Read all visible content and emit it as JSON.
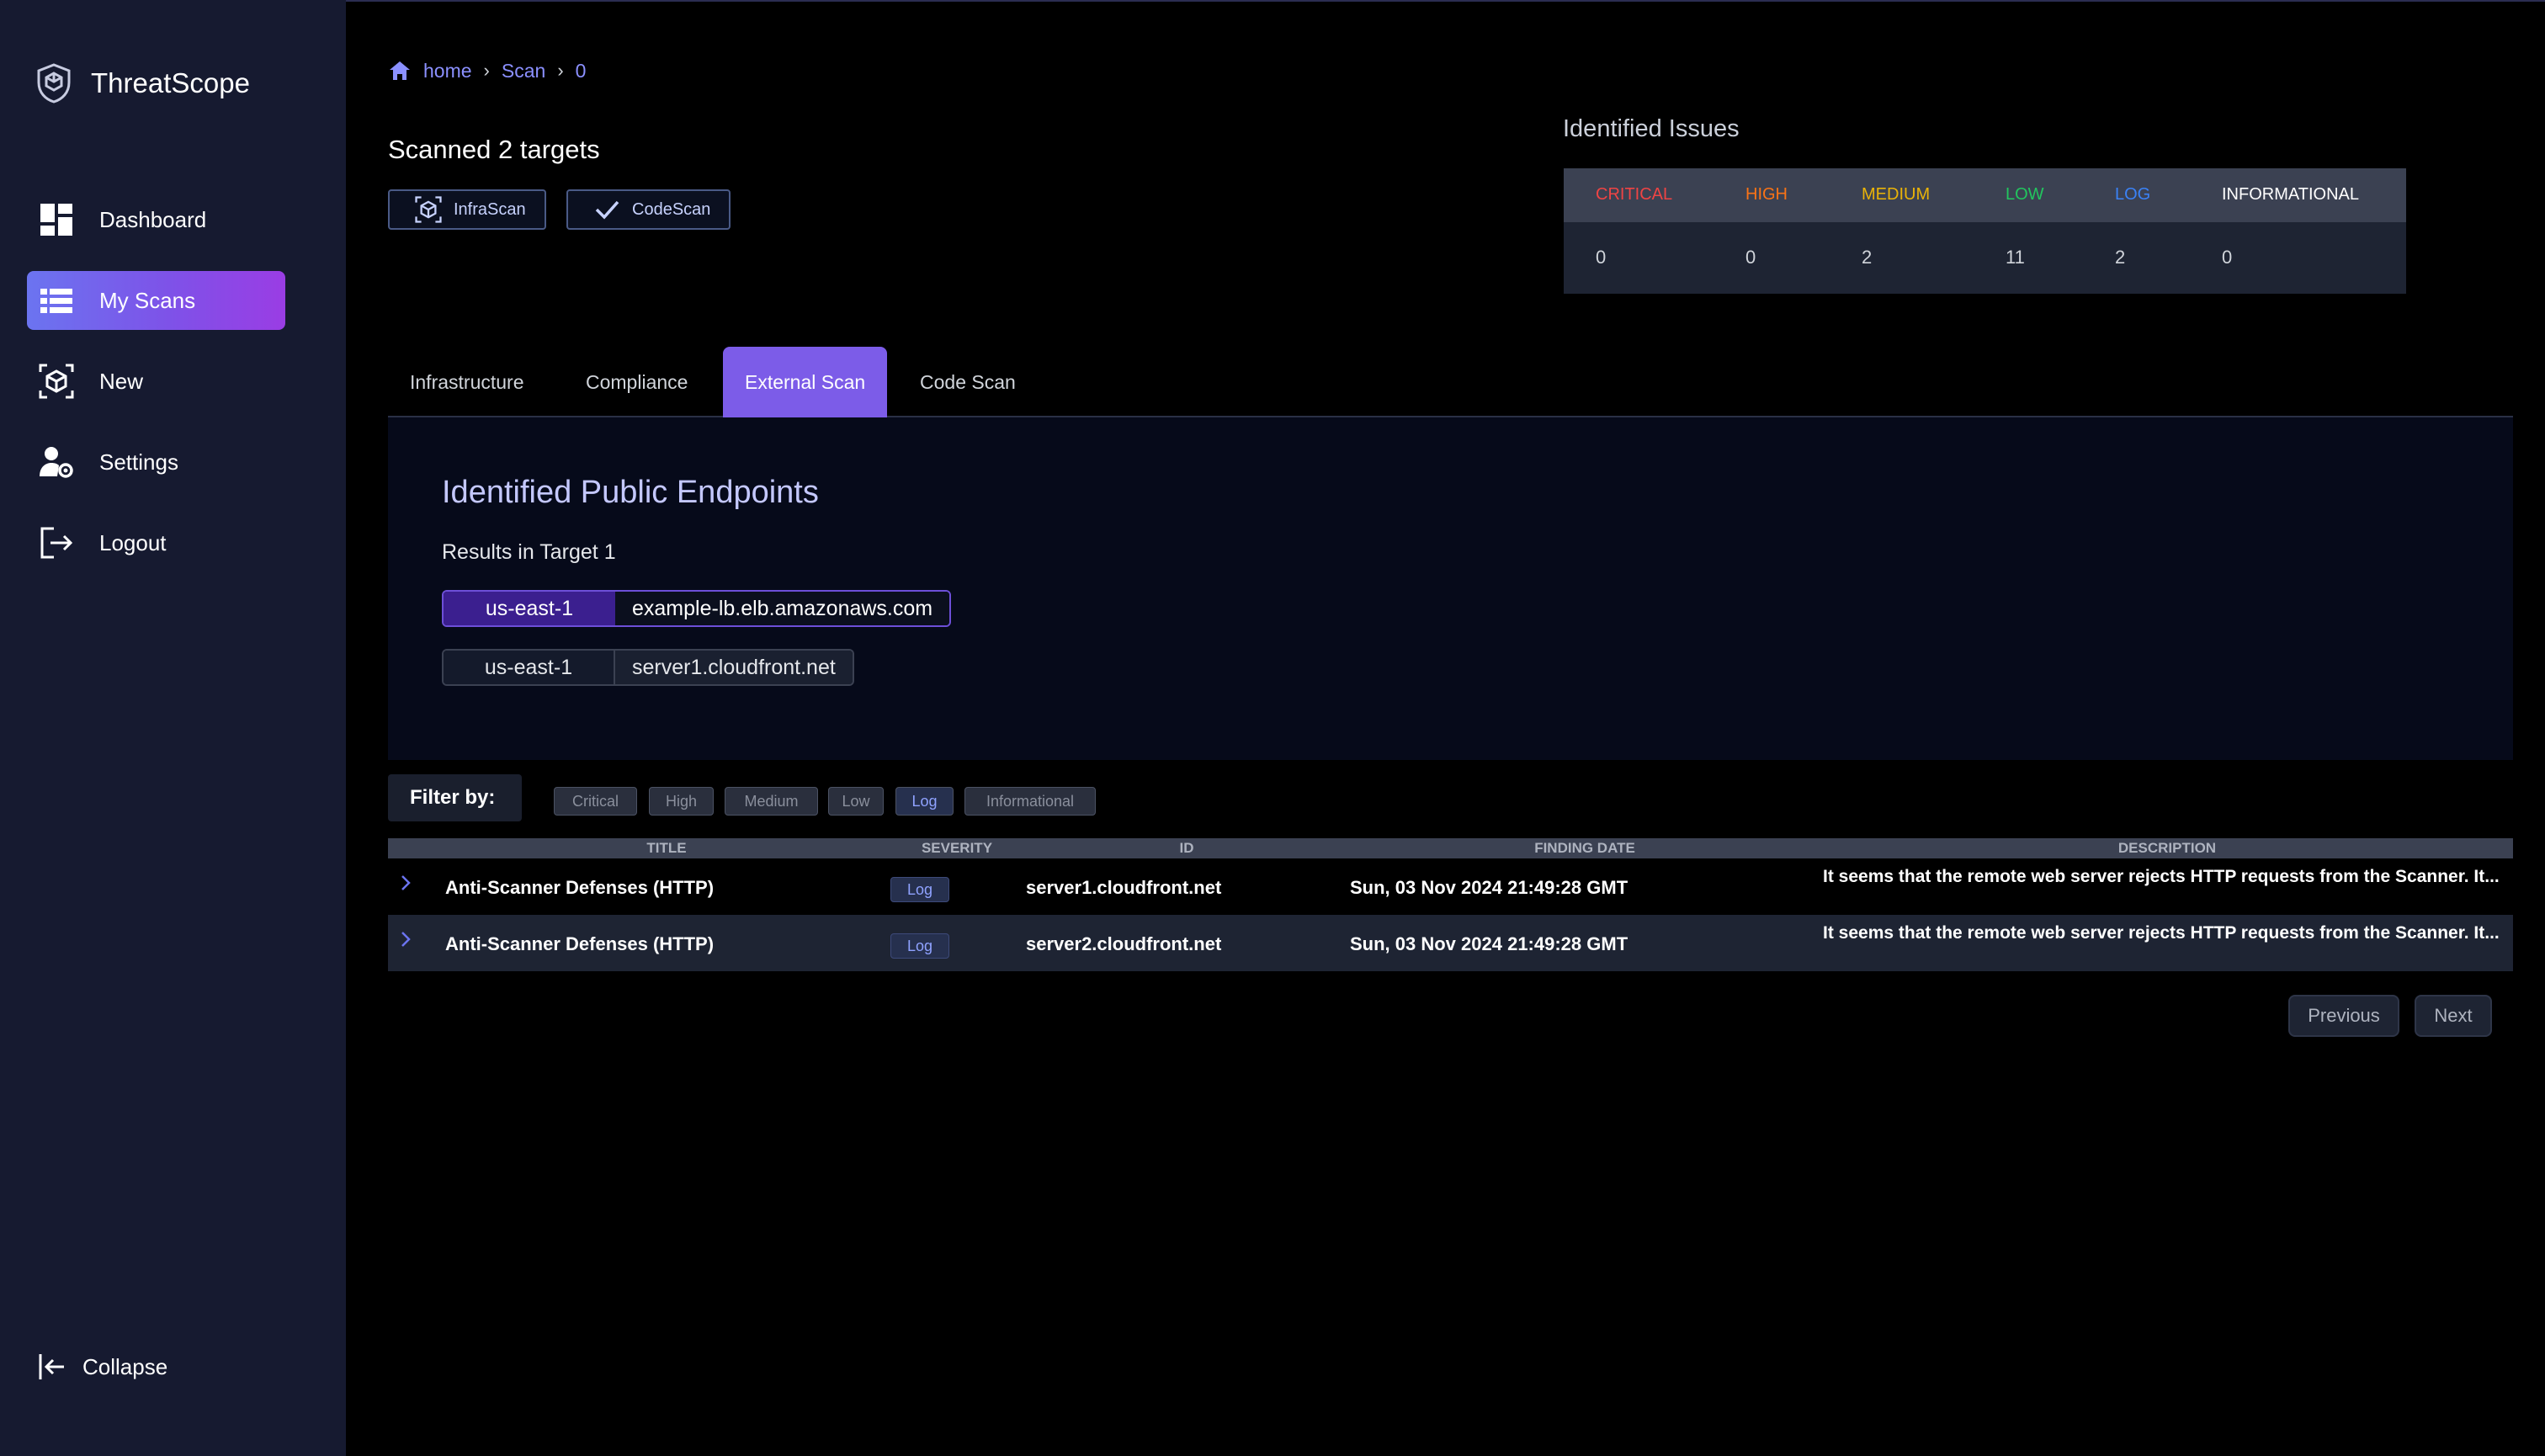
{
  "app": {
    "name": "ThreatScope"
  },
  "sidebar": {
    "items": [
      {
        "label": "Dashboard",
        "icon": "dashboard-icon"
      },
      {
        "label": "My Scans",
        "icon": "list-icon",
        "active": true
      },
      {
        "label": "New",
        "icon": "scan-cube-icon"
      },
      {
        "label": "Settings",
        "icon": "user-gear-icon"
      },
      {
        "label": "Logout",
        "icon": "logout-icon"
      }
    ],
    "collapse_label": "Collapse"
  },
  "breadcrumb": {
    "home": "home",
    "scan": "Scan",
    "id": "0"
  },
  "scan": {
    "title": "Scanned 2 targets",
    "chips": [
      {
        "label": "InfraScan",
        "icon": "scan-cube-icon"
      },
      {
        "label": "CodeScan",
        "icon": "check-icon"
      }
    ]
  },
  "issues": {
    "title": "Identified Issues",
    "columns": [
      {
        "label": "CRITICAL",
        "value": "0",
        "color": "#ef4444"
      },
      {
        "label": "HIGH",
        "value": "0",
        "color": "#f97316"
      },
      {
        "label": "MEDIUM",
        "value": "2",
        "color": "#eab308"
      },
      {
        "label": "LOW",
        "value": "11",
        "color": "#22c55e"
      },
      {
        "label": "LOG",
        "value": "2",
        "color": "#3b82f6"
      },
      {
        "label": "INFORMATIONAL",
        "value": "0",
        "color": "#ffffff"
      }
    ]
  },
  "tabs": [
    {
      "label": "Infrastructure"
    },
    {
      "label": "Compliance"
    },
    {
      "label": "External Scan",
      "active": true
    },
    {
      "label": "Code Scan"
    }
  ],
  "endpoints": {
    "title": "Identified Public Endpoints",
    "subtitle": "Results in Target 1",
    "items": [
      {
        "region": "us-east-1",
        "host": "example-lb.elb.amazonaws.com",
        "selected": true
      },
      {
        "region": "us-east-1",
        "host": "server1.cloudfront.net",
        "selected": false
      }
    ]
  },
  "filter": {
    "label": "Filter by:",
    "options": [
      {
        "label": "Critical",
        "active": false
      },
      {
        "label": "High",
        "active": false
      },
      {
        "label": "Medium",
        "active": false
      },
      {
        "label": "Low",
        "active": false
      },
      {
        "label": "Log",
        "active": true
      },
      {
        "label": "Informational",
        "active": false
      }
    ]
  },
  "findings": {
    "headers": {
      "title": "TITLE",
      "severity": "SEVERITY",
      "id": "ID",
      "date": "FINDING DATE",
      "description": "DESCRIPTION"
    },
    "rows": [
      {
        "title": "Anti-Scanner Defenses (HTTP)",
        "severity": "Log",
        "id": "server1.cloudfront.net",
        "date": "Sun, 03 Nov 2024 21:49:28 GMT",
        "description": "It seems that the remote web server rejects HTTP requests from the Scanner. It..."
      },
      {
        "title": "Anti-Scanner Defenses (HTTP)",
        "severity": "Log",
        "id": "server2.cloudfront.net",
        "date": "Sun, 03 Nov 2024 21:49:28 GMT",
        "description": "It seems that the remote web server rejects HTTP requests from the Scanner. It..."
      }
    ]
  },
  "pagination": {
    "previous": "Previous",
    "next": "Next"
  }
}
